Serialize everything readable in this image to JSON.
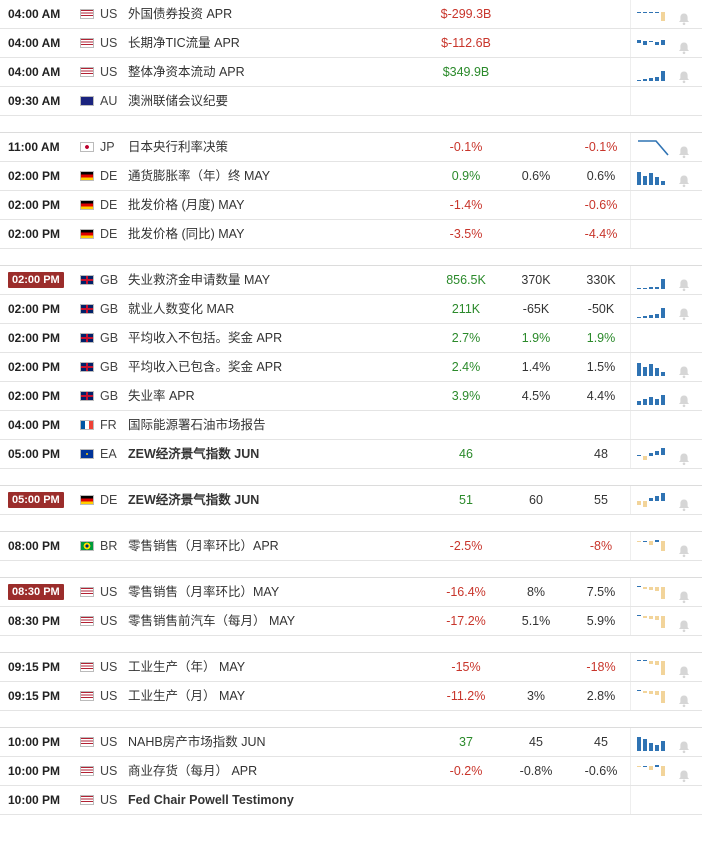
{
  "colors": {
    "positive": "#2b8a2b",
    "negative": "#c8352b",
    "highlight": "#9b2d2b",
    "bar_blue": "#2f73b3",
    "bar_tan": "#f2d49a"
  },
  "groups": [
    {
      "rows": [
        {
          "time": "04:00 AM",
          "country": "US",
          "event": "外国债券投资 APR",
          "actual": "$-299.3B",
          "actual_class": "neg",
          "forecast": "",
          "previous": "",
          "spark": "tan_dash",
          "bell": true
        },
        {
          "time": "04:00 AM",
          "country": "US",
          "event": "长期净TIC流量 APR",
          "actual": "$-112.6B",
          "actual_class": "neg",
          "forecast": "",
          "previous": "",
          "spark": "blue_dash",
          "bell": true
        },
        {
          "time": "04:00 AM",
          "country": "US",
          "event": "整体净资本流动 APR",
          "actual": "$349.9B",
          "actual_class": "pos",
          "forecast": "",
          "previous": "",
          "spark": "blue_bars_up",
          "bell": true
        },
        {
          "time": "09:30 AM",
          "country": "AU",
          "event": "澳洲联储会议纪要",
          "actual": "",
          "actual_class": "neu",
          "forecast": "",
          "previous": "",
          "spark": "",
          "bell": false
        }
      ]
    },
    {
      "rows": [
        {
          "time": "11:00 AM",
          "country": "JP",
          "event": "日本央行利率决策",
          "actual": "-0.1%",
          "actual_class": "neg",
          "forecast": "",
          "previous": "-0.1%",
          "previous_class": "neg",
          "spark": "line_drop",
          "bell": true
        },
        {
          "time": "02:00 PM",
          "country": "DE",
          "event": "通货膨胀率（年）终 MAY",
          "actual": "0.9%",
          "actual_class": "pos",
          "forecast": "0.6%",
          "previous": "0.6%",
          "previous_class": "neu",
          "spark": "blue_bars_down",
          "bell": true
        },
        {
          "time": "02:00 PM",
          "country": "DE",
          "event": "批发价格 (月度) MAY",
          "actual": "-1.4%",
          "actual_class": "neg",
          "forecast": "",
          "previous": "-0.6%",
          "previous_class": "neg",
          "spark": "",
          "bell": false
        },
        {
          "time": "02:00 PM",
          "country": "DE",
          "event": "批发价格 (同比) MAY",
          "actual": "-3.5%",
          "actual_class": "neg",
          "forecast": "",
          "previous": "-4.4%",
          "previous_class": "neg",
          "spark": "",
          "bell": false
        }
      ]
    },
    {
      "rows": [
        {
          "time": "02:00 PM",
          "time_hl": true,
          "country": "GB",
          "event": "失业救济金申请数量 MAY",
          "actual": "856.5K",
          "actual_class": "pos",
          "forecast": "370K",
          "previous": "330K",
          "previous_class": "neu",
          "spark": "blue_bars_rise",
          "bell": true
        },
        {
          "time": "02:00 PM",
          "country": "GB",
          "event": "就业人数变化 MAR",
          "actual": "211K",
          "actual_class": "pos",
          "forecast": "-65K",
          "previous": "-50K",
          "previous_class": "neu",
          "spark": "blue_bars_up",
          "bell": true
        },
        {
          "time": "02:00 PM",
          "country": "GB",
          "event": "平均收入不包括。奖金 APR",
          "actual": "2.7%",
          "actual_class": "pos",
          "forecast": "1.9%",
          "forecast_class": "pos",
          "previous": "1.9%",
          "previous_class": "pos",
          "spark": "",
          "bell": false
        },
        {
          "time": "02:00 PM",
          "country": "GB",
          "event": "平均收入已包含。奖金 APR",
          "actual": "2.4%",
          "actual_class": "pos",
          "forecast": "1.4%",
          "previous": "1.5%",
          "previous_class": "neu",
          "spark": "blue_bars_down",
          "bell": true
        },
        {
          "time": "02:00 PM",
          "country": "GB",
          "event": "失业率 APR",
          "actual": "3.9%",
          "actual_class": "pos",
          "forecast": "4.5%",
          "previous": "4.4%",
          "previous_class": "neu",
          "spark": "blue_bars_up2",
          "bell": true
        },
        {
          "time": "04:00 PM",
          "country": "FR",
          "event": "国际能源署石油市场报告",
          "actual": "",
          "actual_class": "neu",
          "forecast": "",
          "previous": "",
          "spark": "",
          "bell": false
        },
        {
          "time": "05:00 PM",
          "country": "EA",
          "event": "ZEW经济景气指数 JUN",
          "event_bold": true,
          "actual": "46",
          "actual_class": "pos",
          "forecast": "",
          "previous": "48",
          "previous_class": "neu",
          "spark": "mixed_up",
          "bell": true
        }
      ]
    },
    {
      "rows": [
        {
          "time": "05:00 PM",
          "time_hl": true,
          "country": "DE",
          "event": "ZEW经济景气指数 JUN",
          "event_bold": true,
          "actual": "51",
          "actual_class": "pos",
          "forecast": "60",
          "previous": "55",
          "previous_class": "neu",
          "spark": "mixed_up2",
          "bell": true
        }
      ]
    },
    {
      "rows": [
        {
          "time": "08:00 PM",
          "country": "BR",
          "event": "零售销售（月率环比）APR",
          "actual": "-2.5%",
          "actual_class": "neg",
          "forecast": "",
          "previous": "-8%",
          "previous_class": "neg",
          "spark": "tan_mixed",
          "bell": true
        }
      ]
    },
    {
      "rows": [
        {
          "time": "08:30 PM",
          "time_hl": true,
          "country": "US",
          "event": "零售销售（月率环比）MAY",
          "actual": "-16.4%",
          "actual_class": "neg",
          "forecast": "8%",
          "previous": "7.5%",
          "previous_class": "neu",
          "spark": "tan_down",
          "bell": true
        },
        {
          "time": "08:30 PM",
          "country": "US",
          "event": "零售销售前汽车（每月） MAY",
          "actual": "-17.2%",
          "actual_class": "neg",
          "forecast": "5.1%",
          "previous": "5.9%",
          "previous_class": "neu",
          "spark": "tan_down",
          "bell": true
        }
      ]
    },
    {
      "rows": [
        {
          "time": "09:15 PM",
          "country": "US",
          "event": "工业生产（年） MAY",
          "actual": "-15%",
          "actual_class": "neg",
          "forecast": "",
          "previous": "-18%",
          "previous_class": "neg",
          "spark": "tan_down2",
          "bell": true
        },
        {
          "time": "09:15 PM",
          "country": "US",
          "event": "工业生产（月） MAY",
          "actual": "-11.2%",
          "actual_class": "neg",
          "forecast": "3%",
          "previous": "2.8%",
          "previous_class": "neu",
          "spark": "tan_down",
          "bell": true
        }
      ]
    },
    {
      "rows": [
        {
          "time": "10:00 PM",
          "country": "US",
          "event": "NAHB房产市场指数 JUN",
          "actual": "37",
          "actual_class": "pos",
          "forecast": "45",
          "previous": "45",
          "previous_class": "neu",
          "spark": "blue_bars_down2",
          "bell": true
        },
        {
          "time": "10:00 PM",
          "country": "US",
          "event": "商业存货（每月） APR",
          "actual": "-0.2%",
          "actual_class": "neg",
          "forecast": "-0.8%",
          "previous": "-0.6%",
          "previous_class": "neu",
          "spark": "tan_mixed",
          "bell": true
        },
        {
          "time": "10:00 PM",
          "country": "US",
          "event": "Fed Chair Powell Testimony",
          "event_bold": true,
          "actual": "",
          "actual_class": "neu",
          "forecast": "",
          "previous": "",
          "spark": "",
          "bell": false
        }
      ]
    }
  ]
}
